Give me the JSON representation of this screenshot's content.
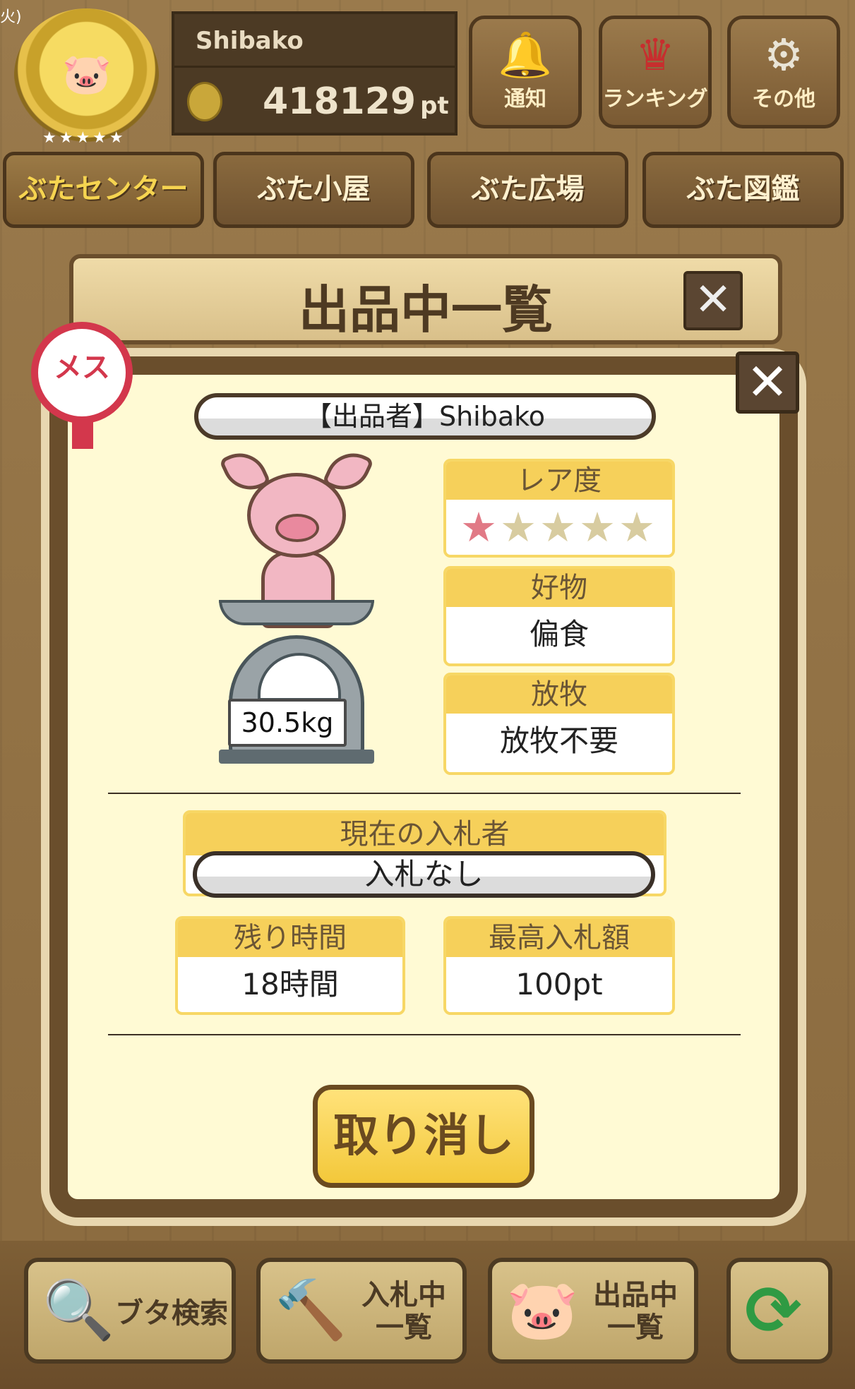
{
  "status_bar": {
    "fragment": "火)"
  },
  "header": {
    "username": "Shibako",
    "points_value": "418129",
    "points_unit": "pt",
    "buttons": [
      {
        "label": "通知",
        "icon": "bell-icon"
      },
      {
        "label": "ランキング",
        "icon": "crown-icon"
      },
      {
        "label": "その他",
        "icon": "gear-icon"
      }
    ]
  },
  "nav": {
    "tabs": [
      {
        "label": "ぶたセンター",
        "active": true
      },
      {
        "label": "ぶた小屋",
        "active": false
      },
      {
        "label": "ぶた広場",
        "active": false
      },
      {
        "label": "ぶた図鑑",
        "active": false
      }
    ]
  },
  "dialog": {
    "title": "出品中一覧",
    "gender_badge": "メス",
    "seller_label": "【出品者】Shibako",
    "weight": "30.5kg",
    "rarity": {
      "header": "レア度",
      "stars_filled": 1,
      "stars_total": 5,
      "star_on": "★",
      "star_off": "★★★★"
    },
    "favorite_food": {
      "header": "好物",
      "value": "偏食"
    },
    "grazing": {
      "header": "放牧",
      "value": "放牧不要"
    },
    "current_bidder": {
      "header": "現在の入札者",
      "value": "入札なし"
    },
    "time_left": {
      "header": "残り時間",
      "value": "18時間"
    },
    "top_bid": {
      "header": "最高入札額",
      "value": "100pt"
    },
    "cancel_label": "取り消し"
  },
  "bottom_bar": {
    "search_label": "ブタ検索",
    "bidding_label": "入札中\n一覧",
    "listing_label": "出品中\n一覧"
  },
  "colors": {
    "accent_yellow": "#f6d05a",
    "wood_dark": "#6a4e2c",
    "panel_bg": "#fffad4",
    "female_red": "#d3374c"
  }
}
